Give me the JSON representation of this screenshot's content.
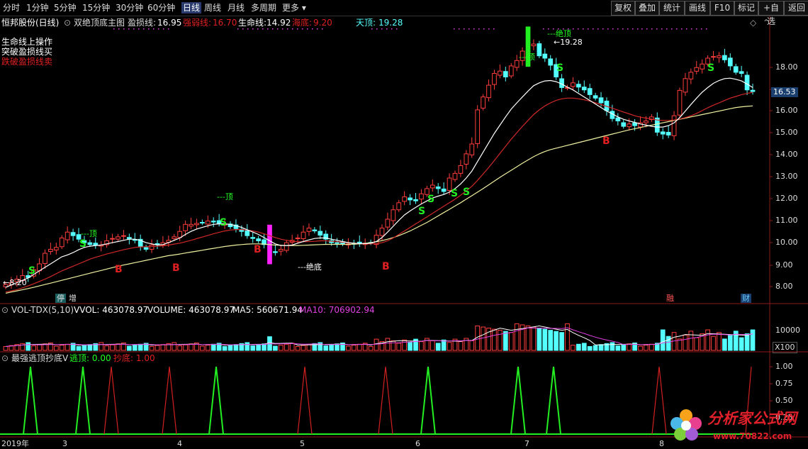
{
  "toolbar": {
    "periods": [
      "分时",
      "1分钟",
      "5分钟",
      "15分钟",
      "30分钟",
      "60分钟",
      "日线",
      "周线",
      "月线",
      "多周期",
      "更多"
    ],
    "active": "日线",
    "right_buttons": [
      "复权",
      "叠加",
      "统计",
      "画线",
      "F10",
      "标记",
      "+自选",
      "返回"
    ]
  },
  "main": {
    "stock": "恒邦股份(日线)",
    "indicator_name": "双绝顶底主图",
    "profit_line_label": "盈损线:",
    "profit_line_value": "16.95",
    "strength_label": "强弱线:",
    "strength_value": "16.70",
    "life_label": "生命线:",
    "life_value": "14.92",
    "sea_bottom_label": "海底:",
    "sea_bottom_value": "9.20",
    "sky_top_label": "天顶:",
    "sky_top_value": "19.28",
    "legend": [
      "生命线上操作",
      "突破盈损线买",
      "跌破盈损线卖"
    ],
    "price_axis": [
      "18.00",
      "17.00",
      "16.00",
      "15.00",
      "14.00",
      "13.00",
      "12.00",
      "11.00",
      "10.00",
      "9.00",
      "8.00"
    ],
    "current_price": "16.53",
    "low_marker": "8.20",
    "high_marker": "19.28",
    "top_label": "---顶",
    "abs_top_label": "---绝顶",
    "abs_bottom_label": "---绝底",
    "buy_mark": "B",
    "sell_mark": "S",
    "bottom_tags": [
      {
        "text": "停",
        "color": "#6fc"
      },
      {
        "text": "增",
        "color": "#ddd"
      },
      {
        "text": "融",
        "color": "#f55"
      },
      {
        "text": "财",
        "color": "#6cf"
      }
    ]
  },
  "volume": {
    "name": "VOL-TDX(5,10)",
    "vvol_label": "VVOL:",
    "vvol_value": "463078.97",
    "volume_label": "VOLUME:",
    "volume_value": "463078.97",
    "ma5_label": "MA5:",
    "ma5_value": "560671.94",
    "ma10_label": "MA10:",
    "ma10_value": "706902.94",
    "axis_label": "10000",
    "unit": "X100"
  },
  "escape": {
    "name": "最强逃顶抄底V",
    "escape_label": "逃顶:",
    "escape_value": "0.00",
    "bottom_label": "抄底:",
    "bottom_value": "1.00",
    "axis": [
      "1.00",
      "0.75",
      "0.50",
      "0.25"
    ]
  },
  "xaxis": {
    "labels": [
      "2019年",
      "3",
      "4",
      "5",
      "6",
      "7",
      "8"
    ]
  },
  "watermark": {
    "title": "分析家公式网",
    "url": "www.70822.com"
  },
  "colors": {
    "up": "#ff3d3d",
    "down": "#54ffff",
    "ma_white": "#ffffff",
    "ma_red": "#d02828",
    "ma_yellow": "#f0f0a0",
    "green": "#22ee22",
    "magenta": "#ff22ff",
    "grid": "#8b1a1a"
  },
  "chart_data": {
    "type": "candlestick",
    "closes": [
      8.32,
      8.4,
      8.55,
      8.7,
      8.62,
      8.95,
      9.2,
      9.65,
      9.82,
      9.9,
      10.3,
      10.55,
      10.4,
      10.25,
      10.1,
      10.02,
      10.0,
      10.0,
      10.18,
      10.28,
      10.35,
      10.4,
      10.25,
      10.2,
      9.95,
      9.82,
      10.0,
      10.05,
      10.1,
      10.2,
      10.35,
      10.58,
      10.88,
      10.88,
      10.92,
      10.95,
      11.02,
      10.98,
      10.92,
      10.88,
      10.78,
      10.7,
      10.58,
      10.4,
      10.28,
      10.18,
      10.02,
      9.72,
      9.68,
      9.82,
      10.1,
      10.2,
      10.3,
      10.55,
      10.72,
      10.6,
      10.42,
      10.25,
      10.1,
      10.08,
      10.05,
      10.05,
      10.05,
      10.05,
      10.08,
      10.1,
      10.42,
      10.72,
      11.1,
      11.5,
      11.8,
      12.05,
      11.92,
      11.88,
      12.18,
      12.4,
      12.55,
      12.4,
      12.28,
      12.85,
      13.05,
      13.38,
      13.88,
      14.3,
      15.75,
      16.3,
      16.8,
      17.3,
      17.4,
      17.15,
      17.62,
      17.85,
      18.25,
      18.52,
      18.55,
      18.05,
      17.95,
      17.65,
      17.15,
      16.7,
      16.7,
      16.9,
      16.72,
      16.6,
      16.4,
      16.25,
      16.05,
      15.72,
      15.38,
      15.28,
      15.05,
      15.15,
      15.08,
      15.2,
      15.28,
      15.45,
      14.8,
      14.72,
      14.68,
      15.5,
      16.58,
      17.08,
      17.35,
      17.55,
      17.7,
      17.95,
      18.02,
      18.05,
      17.88,
      17.62,
      17.35,
      17.3,
      16.6,
      16.53
    ],
    "ma_white": [
      8.2,
      8.3,
      8.4,
      8.5,
      8.6,
      8.75,
      8.9,
      9.05,
      9.2,
      9.35,
      9.5,
      9.58,
      9.68,
      9.8,
      9.9,
      9.95,
      9.98,
      10.0,
      10.05,
      10.1,
      10.15,
      10.2,
      10.25,
      10.25,
      10.2,
      10.1,
      10.05,
      10.0,
      10.02,
      10.1,
      10.2,
      10.3,
      10.45,
      10.58,
      10.68,
      10.75,
      10.82,
      10.88,
      10.9,
      10.9,
      10.88,
      10.82,
      10.75,
      10.65,
      10.55,
      10.45,
      10.32,
      10.18,
      10.05,
      9.98,
      9.98,
      10.0,
      10.08,
      10.15,
      10.22,
      10.28,
      10.3,
      10.3,
      10.25,
      10.2,
      10.15,
      10.1,
      10.08,
      10.06,
      10.06,
      10.08,
      10.15,
      10.32,
      10.55,
      10.8,
      11.05,
      11.28,
      11.45,
      11.6,
      11.75,
      11.88,
      12.0,
      12.08,
      12.15,
      12.25,
      12.4,
      12.6,
      12.85,
      13.15,
      13.55,
      13.95,
      14.35,
      14.75,
      15.1,
      15.45,
      15.78,
      16.05,
      16.3,
      16.55,
      16.78,
      16.9,
      16.98,
      17.0,
      16.95,
      16.85,
      16.72,
      16.6,
      16.45,
      16.3,
      16.15,
      16.0,
      15.85,
      15.7,
      15.58,
      15.45,
      15.35,
      15.28,
      15.22,
      15.15,
      15.1,
      15.05,
      15.02,
      15.02,
      15.08,
      15.2,
      15.42,
      15.7,
      15.98,
      16.25,
      16.5,
      16.7,
      16.88,
      17.0,
      17.08,
      17.1,
      17.05,
      16.98,
      16.85,
      16.7
    ],
    "ma_red": [
      8.0,
      8.05,
      8.1,
      8.18,
      8.26,
      8.35,
      8.45,
      8.55,
      8.66,
      8.78,
      8.9,
      9.0,
      9.1,
      9.2,
      9.3,
      9.4,
      9.48,
      9.55,
      9.62,
      9.68,
      9.74,
      9.8,
      9.85,
      9.9,
      9.92,
      9.93,
      9.94,
      9.95,
      9.97,
      10.0,
      10.04,
      10.08,
      10.14,
      10.2,
      10.27,
      10.34,
      10.41,
      10.48,
      10.54,
      10.6,
      10.64,
      10.66,
      10.66,
      10.64,
      10.6,
      10.55,
      10.48,
      10.4,
      10.32,
      10.25,
      10.2,
      10.16,
      10.14,
      10.14,
      10.15,
      10.16,
      10.18,
      10.18,
      10.16,
      10.14,
      10.12,
      10.1,
      10.08,
      10.06,
      10.05,
      10.05,
      10.06,
      10.1,
      10.18,
      10.3,
      10.45,
      10.6,
      10.75,
      10.9,
      11.05,
      11.2,
      11.35,
      11.5,
      11.65,
      11.8,
      11.95,
      12.12,
      12.3,
      12.5,
      12.75,
      13.02,
      13.3,
      13.6,
      13.9,
      14.2,
      14.5,
      14.78,
      15.05,
      15.3,
      15.55,
      15.75,
      15.92,
      16.05,
      16.15,
      16.22,
      16.25,
      16.25,
      16.22,
      16.18,
      16.12,
      16.05,
      15.98,
      15.9,
      15.82,
      15.74,
      15.66,
      15.58,
      15.5,
      15.44,
      15.4,
      15.36,
      15.32,
      15.3,
      15.3,
      15.32,
      15.36,
      15.42,
      15.5,
      15.6,
      15.72,
      15.84,
      15.95,
      16.05,
      16.15,
      16.25,
      16.32,
      16.4,
      16.45,
      16.5
    ],
    "ma_yellow": [
      7.95,
      8.0,
      8.05,
      8.1,
      8.15,
      8.2,
      8.26,
      8.32,
      8.38,
      8.44,
      8.5,
      8.56,
      8.62,
      8.68,
      8.74,
      8.8,
      8.86,
      8.92,
      8.98,
      9.04,
      9.1,
      9.15,
      9.2,
      9.25,
      9.3,
      9.35,
      9.4,
      9.45,
      9.5,
      9.55,
      9.58,
      9.62,
      9.66,
      9.7,
      9.74,
      9.78,
      9.82,
      9.86,
      9.9,
      9.94,
      9.97,
      10.0,
      10.02,
      10.04,
      10.05,
      10.05,
      10.04,
      10.02,
      10.0,
      9.99,
      9.98,
      9.98,
      9.98,
      9.99,
      10.0,
      10.01,
      10.02,
      10.03,
      10.03,
      10.03,
      10.03,
      10.03,
      10.04,
      10.05,
      10.07,
      10.1,
      10.14,
      10.19,
      10.25,
      10.32,
      10.4,
      10.5,
      10.6,
      10.72,
      10.84,
      10.96,
      11.1,
      11.24,
      11.38,
      11.52,
      11.66,
      11.8,
      11.95,
      12.1,
      12.25,
      12.4,
      12.56,
      12.72,
      12.88,
      13.03,
      13.18,
      13.33,
      13.48,
      13.62,
      13.76,
      13.88,
      13.98,
      14.06,
      14.12,
      14.18,
      14.24,
      14.3,
      14.36,
      14.42,
      14.48,
      14.54,
      14.6,
      14.66,
      14.72,
      14.78,
      14.84,
      14.9,
      14.95,
      15.0,
      15.05,
      15.1,
      15.15,
      15.2,
      15.25,
      15.3,
      15.35,
      15.4,
      15.45,
      15.5,
      15.55,
      15.6,
      15.65,
      15.7,
      15.75,
      15.8,
      15.85,
      15.88,
      15.9,
      15.92
    ],
    "ylim": [
      7.6,
      19.7
    ]
  }
}
